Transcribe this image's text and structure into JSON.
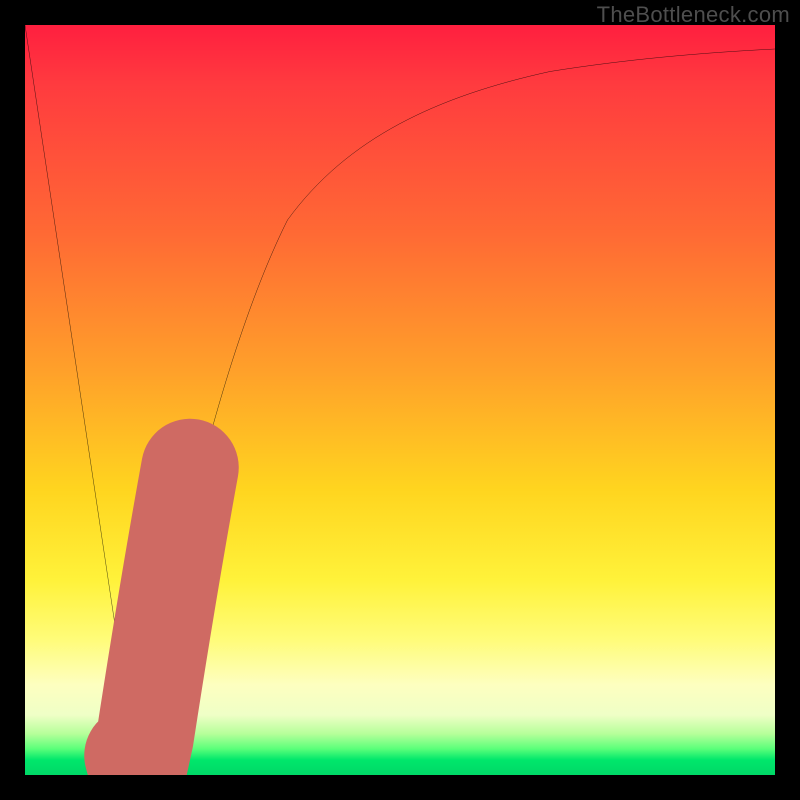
{
  "watermark": {
    "text": "TheBottleneck.com"
  },
  "chart_data": {
    "type": "line",
    "title": "",
    "xlabel": "",
    "ylabel": "",
    "xlim": [
      0,
      100
    ],
    "ylim": [
      0,
      100
    ],
    "grid": false,
    "legend": false,
    "series": [
      {
        "name": "black-curve",
        "color": "#000000",
        "x": [
          0,
          5,
          10,
          12,
          14,
          15,
          17,
          20,
          25,
          30,
          35,
          40,
          45,
          50,
          55,
          60,
          65,
          70,
          75,
          80,
          85,
          90,
          95,
          100
        ],
        "y": [
          100,
          67,
          33,
          20,
          7,
          0,
          12,
          30,
          52,
          65,
          74,
          80,
          84,
          87,
          89,
          91,
          92.5,
          93.5,
          94.3,
          95,
          95.6,
          96.1,
          96.5,
          96.8
        ]
      },
      {
        "name": "red-highlight",
        "color": "#cf6a63",
        "x": [
          14.5,
          15,
          16,
          18,
          20,
          22
        ],
        "y": [
          2.5,
          0.5,
          5,
          17,
          30,
          41
        ]
      }
    ],
    "gradient_bands": [
      {
        "color": "#ff1f3f",
        "y": 100
      },
      {
        "color": "#ffa02a",
        "y": 55
      },
      {
        "color": "#fff23a",
        "y": 25
      },
      {
        "color": "#00e76b",
        "y": 2
      }
    ]
  }
}
